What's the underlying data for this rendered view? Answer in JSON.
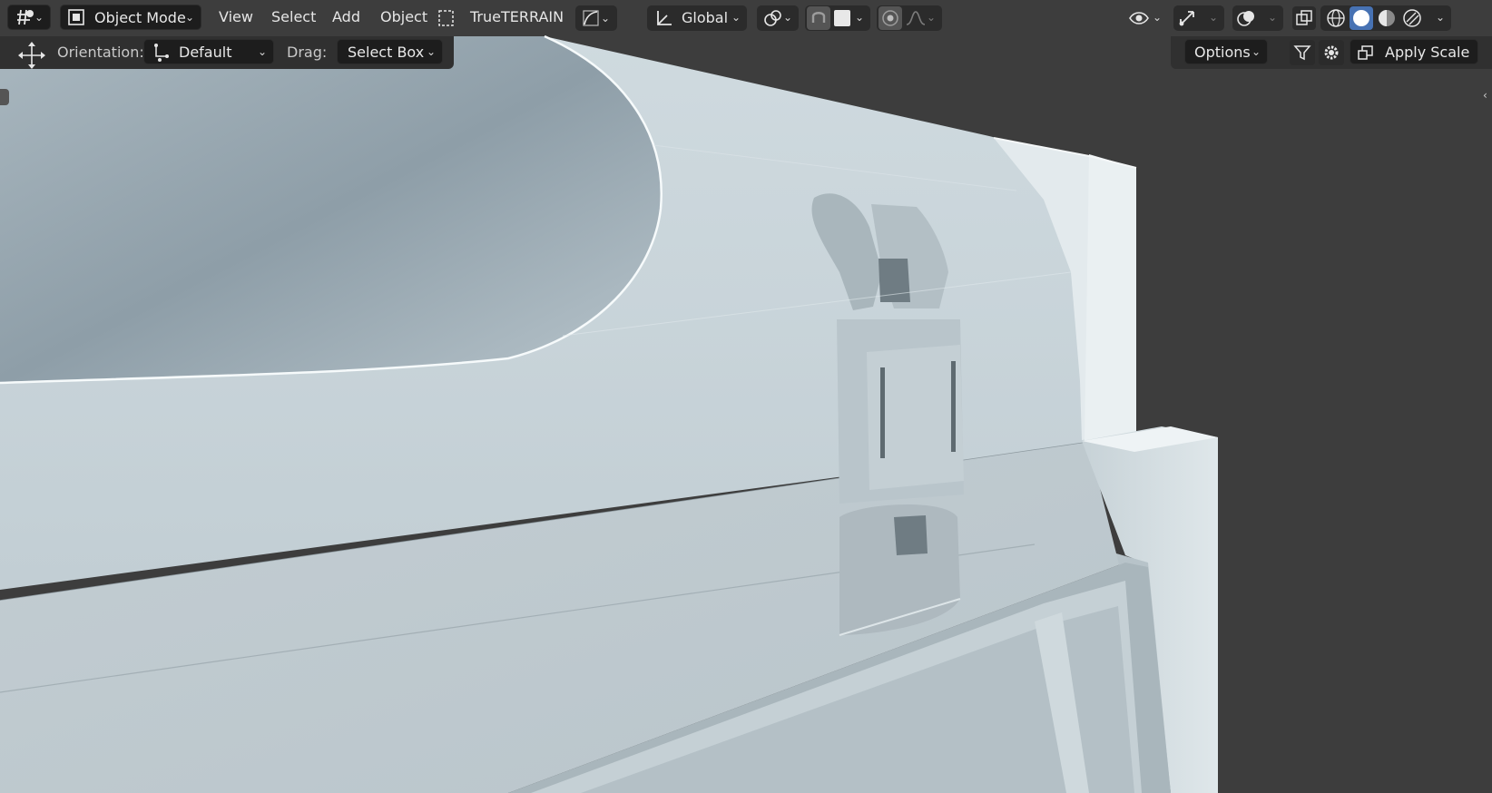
{
  "header": {
    "editor_type_icon": "grid-editor-icon",
    "mode": {
      "label": "Object Mode",
      "icon": "object-mode-icon"
    },
    "menus": [
      "View",
      "Select",
      "Add",
      "Object"
    ],
    "addon_label": "TrueTERRAIN",
    "transform_orientation": "Global",
    "icons": [
      "pivot-icon",
      "snap-icon",
      "proportional-editing-icon",
      "visibility-icon",
      "gizmo-icon",
      "overlay-icon",
      "xray-icon",
      "shading-wireframe-icon",
      "shading-solid-icon",
      "shading-material-icon",
      "shading-rendered-icon"
    ]
  },
  "tool_settings": {
    "orientation_label": "Orientation:",
    "orientation_value": "Default",
    "drag_label": "Drag:",
    "drag_value": "Select Box",
    "options_label": "Options",
    "apply_scale_label": "Apply Scale"
  },
  "colors": {
    "header_bg": "#3d3d3d",
    "button_bg": "#1d1d1d",
    "accent_active": "#4772b3",
    "model_base": "#d3dde2"
  }
}
